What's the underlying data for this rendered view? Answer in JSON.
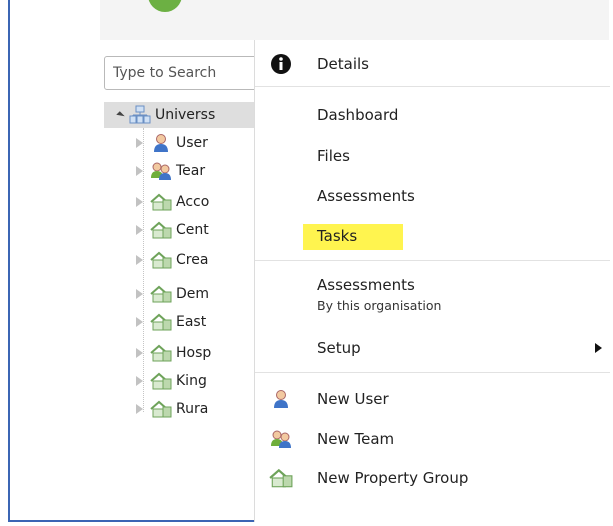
{
  "search": {
    "placeholder": "Type to Search"
  },
  "tree": {
    "root": "Universs",
    "items": [
      "User",
      "Tear",
      "Acco",
      "Cent",
      "Crea",
      "Dem",
      "East",
      "Hosp",
      "King",
      "Rura"
    ]
  },
  "menu": {
    "details": "Details",
    "dashboard": "Dashboard",
    "files": "Files",
    "assessments": "Assessments",
    "tasks": "Tasks",
    "assessments_org": "Assessments",
    "assessments_org_sub": "By this organisation",
    "setup": "Setup",
    "new_user": "New User",
    "new_team": "New Team",
    "new_property_group": "New Property Group"
  },
  "colors": {
    "frame_border": "#3b65b4",
    "highlight": "#fff44f",
    "logo_green": "#6cb043"
  }
}
